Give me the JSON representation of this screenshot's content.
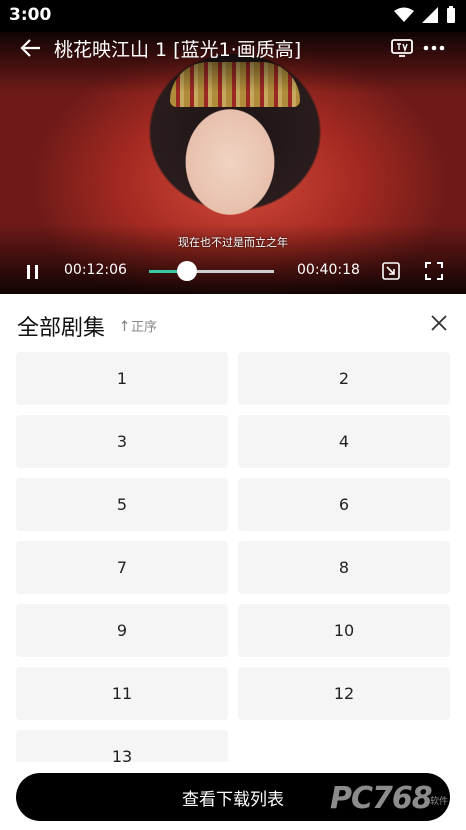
{
  "status_bar": {
    "time": "3:00"
  },
  "player": {
    "title": "桃花映江山 1 [蓝光1·画质高]",
    "subtitle": "现在也不过是而立之年",
    "current_time": "00:12:06",
    "total_time": "00:40:18",
    "progress": 0.3
  },
  "episodes_panel": {
    "title": "全部剧集",
    "sort_label": "正序",
    "episodes": [
      "1",
      "2",
      "3",
      "4",
      "5",
      "6",
      "7",
      "8",
      "9",
      "10",
      "11",
      "12",
      "13"
    ]
  },
  "download_button": {
    "label": "查看下载列表"
  },
  "watermark": {
    "brand": "PC768",
    "sub": "软件"
  }
}
